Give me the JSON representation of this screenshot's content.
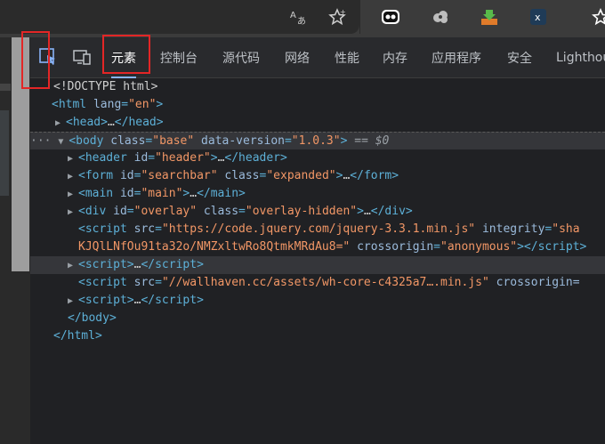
{
  "browser": {
    "icons": [
      "translate-icon",
      "star-icon",
      "extension-owl-icon",
      "extension-cloud-icon",
      "download-extension-icon",
      "x-extension-icon",
      "favorites-icon"
    ]
  },
  "devtools": {
    "tabs": [
      {
        "label": "元素",
        "active": true
      },
      {
        "label": "控制台"
      },
      {
        "label": "源代码"
      },
      {
        "label": "网络"
      },
      {
        "label": "性能"
      },
      {
        "label": "内存"
      },
      {
        "label": "应用程序"
      },
      {
        "label": "安全"
      },
      {
        "label": "Lighthou"
      }
    ],
    "dom": {
      "doctype": "<!DOCTYPE html>",
      "html_open": "html",
      "html_lang_attr": "lang",
      "html_lang_val": "\"en\"",
      "head": "head",
      "body_tag": "body",
      "body_class_attr": "class",
      "body_class_val": "\"base\"",
      "body_dv_attr": "data-version",
      "body_dv_val": "\"1.0.3\"",
      "body_eq": " == $0",
      "header_id_val": "\"header\"",
      "form_id_val": "\"searchbar\"",
      "form_class_val": "\"expanded\"",
      "main_id_val": "\"main\"",
      "div_id_val": "\"overlay\"",
      "div_class_val": "\"overlay-hidden\"",
      "script1_src": "\"https://code.jquery.com/jquery-3.3.1.min.js\"",
      "script1_integrity_attr": "integrity",
      "script1_integrity_val": "\"sha",
      "script1_line2": "KJQlLNfOu91ta32o/NMZxltwRo8QtmkMRdAu8=\"",
      "script1_crossorigin_val": "\"anonymous\"",
      "script3_src": "\"//wallhaven.cc/assets/wh-core-c4325a7….min.js\"",
      "script3_crossorigin": "crossorigin=",
      "ellipsis": "…",
      "close_body": "</body>",
      "close_html": "</html>"
    }
  }
}
